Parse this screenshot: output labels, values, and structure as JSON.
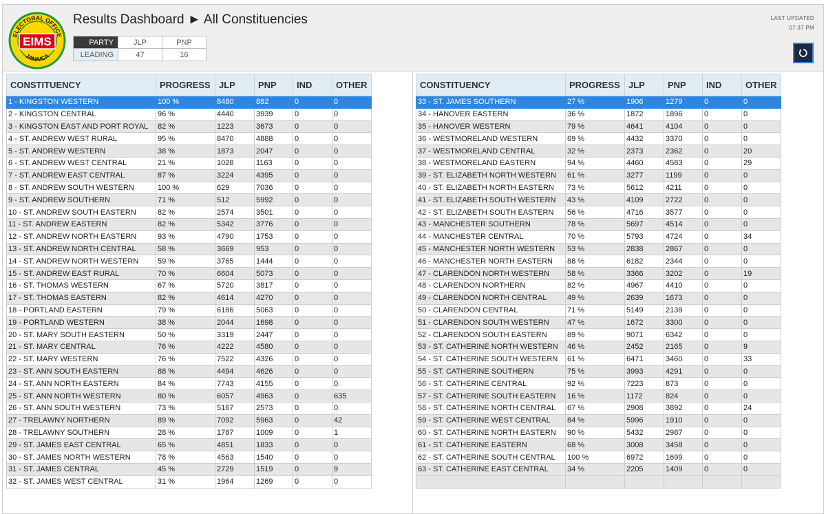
{
  "header": {
    "title": "Results Dashboard ► All Constituencies",
    "last_updated_label": "LAST UPDATED",
    "last_updated_time": "07:37 PM"
  },
  "logo": {
    "text": "EIMS",
    "arc_top": "ELECTORAL OFFICE",
    "arc_bottom": "JAMAICA",
    "colors": {
      "red": "#e0001b",
      "yellow": "#ffd500",
      "green": "#1f9a3a"
    }
  },
  "party_summary": {
    "party_label": "PARTY",
    "leading_label": "LEADING",
    "parties": [
      {
        "name": "JLP",
        "leading": "47"
      },
      {
        "name": "PNP",
        "leading": "16"
      }
    ]
  },
  "columns": [
    "CONSTITUENCY",
    "PROGRESS",
    "JLP",
    "PNP",
    "IND",
    "OTHER"
  ],
  "left_table": {
    "rows": [
      [
        "1 - KINGSTON WESTERN",
        "100 %",
        "8480",
        "882",
        "0",
        "0"
      ],
      [
        "2 - KINGSTON CENTRAL",
        "96 %",
        "4440",
        "3939",
        "0",
        "0"
      ],
      [
        "3 - KINGSTON EAST AND PORT ROYAL",
        "82 %",
        "1223",
        "3673",
        "0",
        "0"
      ],
      [
        "4 - ST. ANDREW WEST RURAL",
        "95 %",
        "8470",
        "4888",
        "0",
        "0"
      ],
      [
        "5 - ST. ANDREW WESTERN",
        "38 %",
        "1873",
        "2047",
        "0",
        "0"
      ],
      [
        "6 - ST. ANDREW WEST CENTRAL",
        "21 %",
        "1028",
        "1163",
        "0",
        "0"
      ],
      [
        "7 - ST. ANDREW EAST CENTRAL",
        "87 %",
        "3224",
        "4395",
        "0",
        "0"
      ],
      [
        "8 - ST. ANDREW SOUTH WESTERN",
        "100 %",
        "629",
        "7036",
        "0",
        "0"
      ],
      [
        "9 - ST. ANDREW SOUTHERN",
        "71 %",
        "512",
        "5992",
        "0",
        "0"
      ],
      [
        "10 - ST. ANDREW SOUTH EASTERN",
        "82 %",
        "2574",
        "3501",
        "0",
        "0"
      ],
      [
        "11 - ST. ANDREW EASTERN",
        "82 %",
        "5342",
        "3776",
        "0",
        "0"
      ],
      [
        "12 - ST. ANDREW NORTH EASTERN",
        "93 %",
        "4790",
        "1753",
        "0",
        "0"
      ],
      [
        "13 - ST. ANDREW NORTH CENTRAL",
        "58 %",
        "3669",
        "953",
        "0",
        "0"
      ],
      [
        "14 - ST. ANDREW NORTH WESTERN",
        "59 %",
        "3765",
        "1444",
        "0",
        "0"
      ],
      [
        "15 - ST. ANDREW EAST RURAL",
        "70 %",
        "6604",
        "5073",
        "0",
        "0"
      ],
      [
        "16 - ST. THOMAS WESTERN",
        "67 %",
        "5720",
        "3817",
        "0",
        "0"
      ],
      [
        "17 - ST. THOMAS EASTERN",
        "82 %",
        "4614",
        "4270",
        "0",
        "0"
      ],
      [
        "18 - PORTLAND EASTERN",
        "79 %",
        "6186",
        "5063",
        "0",
        "0"
      ],
      [
        "19 - PORTLAND WESTERN",
        "38 %",
        "2044",
        "1698",
        "0",
        "0"
      ],
      [
        "20 - ST. MARY SOUTH EASTERN",
        "50 %",
        "3319",
        "2447",
        "0",
        "0"
      ],
      [
        "21 - ST. MARY CENTRAL",
        "76 %",
        "4222",
        "4580",
        "0",
        "0"
      ],
      [
        "22 - ST. MARY WESTERN",
        "76 %",
        "7522",
        "4326",
        "0",
        "0"
      ],
      [
        "23 - ST. ANN SOUTH EASTERN",
        "88 %",
        "4494",
        "4626",
        "0",
        "0"
      ],
      [
        "24 - ST. ANN NORTH EASTERN",
        "84 %",
        "7743",
        "4155",
        "0",
        "0"
      ],
      [
        "25 - ST. ANN NORTH WESTERN",
        "80 %",
        "6057",
        "4963",
        "0",
        "635"
      ],
      [
        "26 - ST. ANN SOUTH WESTERN",
        "73 %",
        "5167",
        "2573",
        "0",
        "0"
      ],
      [
        "27 - TRELAWNY NORTHERN",
        "89 %",
        "7092",
        "5963",
        "0",
        "42"
      ],
      [
        "28 - TRELAWNY SOUTHERN",
        "28 %",
        "1767",
        "1009",
        "0",
        "1"
      ],
      [
        "29 - ST. JAMES EAST CENTRAL",
        "65 %",
        "4851",
        "1833",
        "0",
        "0"
      ],
      [
        "30 - ST. JAMES NORTH WESTERN",
        "78 %",
        "4563",
        "1540",
        "0",
        "0"
      ],
      [
        "31 - ST. JAMES CENTRAL",
        "45 %",
        "2729",
        "1519",
        "0",
        "9"
      ],
      [
        "32 - ST. JAMES WEST CENTRAL",
        "31 %",
        "1964",
        "1269",
        "0",
        "0"
      ]
    ]
  },
  "right_table": {
    "rows": [
      [
        "33 - ST. JAMES SOUTHERN",
        "27 %",
        "1906",
        "1279",
        "0",
        "0"
      ],
      [
        "34 - HANOVER EASTERN",
        "36 %",
        "1872",
        "1896",
        "0",
        "0"
      ],
      [
        "35 - HANOVER WESTERN",
        "79 %",
        "4641",
        "4104",
        "0",
        "0"
      ],
      [
        "36 - WESTMORELAND WESTERN",
        "69 %",
        "4432",
        "3370",
        "0",
        "0"
      ],
      [
        "37 - WESTMORELAND CENTRAL",
        "32 %",
        "2373",
        "2362",
        "0",
        "20"
      ],
      [
        "38 - WESTMORELAND EASTERN",
        "94 %",
        "4460",
        "4583",
        "0",
        "29"
      ],
      [
        "39 - ST. ELIZABETH NORTH WESTERN",
        "61 %",
        "3277",
        "1199",
        "0",
        "0"
      ],
      [
        "40 - ST. ELIZABETH NORTH EASTERN",
        "73 %",
        "5612",
        "4211",
        "0",
        "0"
      ],
      [
        "41 - ST. ELIZABETH SOUTH WESTERN",
        "43 %",
        "4109",
        "2722",
        "0",
        "0"
      ],
      [
        "42 - ST. ELIZABETH SOUTH EASTERN",
        "56 %",
        "4716",
        "3577",
        "0",
        "0"
      ],
      [
        "43 - MANCHESTER SOUTHERN",
        "78 %",
        "5697",
        "4514",
        "0",
        "0"
      ],
      [
        "44 - MANCHESTER CENTRAL",
        "70 %",
        "5793",
        "4724",
        "0",
        "34"
      ],
      [
        "45 - MANCHESTER NORTH WESTERN",
        "53 %",
        "2838",
        "2867",
        "0",
        "0"
      ],
      [
        "46 - MANCHESTER NORTH EASTERN",
        "88 %",
        "6182",
        "2344",
        "0",
        "0"
      ],
      [
        "47 - CLARENDON NORTH WESTERN",
        "58 %",
        "3366",
        "3202",
        "0",
        "19"
      ],
      [
        "48 - CLARENDON NORTHERN",
        "82 %",
        "4967",
        "4410",
        "0",
        "0"
      ],
      [
        "49 - CLARENDON NORTH CENTRAL",
        "49 %",
        "2639",
        "1673",
        "0",
        "0"
      ],
      [
        "50 - CLARENDON CENTRAL",
        "71 %",
        "5149",
        "2138",
        "0",
        "0"
      ],
      [
        "51 - CLARENDON SOUTH WESTERN",
        "47 %",
        "1672",
        "3300",
        "0",
        "0"
      ],
      [
        "52 - CLARENDON SOUTH EASTERN",
        "89 %",
        "9071",
        "6342",
        "0",
        "0"
      ],
      [
        "53 - ST. CATHERINE NORTH WESTERN",
        "46 %",
        "2452",
        "2165",
        "0",
        "9"
      ],
      [
        "54 - ST. CATHERINE SOUTH WESTERN",
        "61 %",
        "6471",
        "3460",
        "0",
        "33"
      ],
      [
        "55 - ST. CATHERINE SOUTHERN",
        "75 %",
        "3993",
        "4291",
        "0",
        "0"
      ],
      [
        "56 - ST. CATHERINE CENTRAL",
        "92 %",
        "7223",
        "873",
        "0",
        "0"
      ],
      [
        "57 - ST. CATHERINE SOUTH EASTERN",
        "16 %",
        "1172",
        "824",
        "0",
        "0"
      ],
      [
        "58 - ST. CATHERINE NORTH CENTRAL",
        "67 %",
        "2908",
        "3892",
        "0",
        "24"
      ],
      [
        "59 - ST. CATHERINE WEST CENTRAL",
        "84 %",
        "5996",
        "1910",
        "0",
        "0"
      ],
      [
        "60 - ST. CATHERINE NORTH EASTERN",
        "90 %",
        "5432",
        "2987",
        "0",
        "0"
      ],
      [
        "61 - ST. CATHERINE EASTERN",
        "68 %",
        "3008",
        "3458",
        "0",
        "0"
      ],
      [
        "62 - ST. CATHERINE SOUTH CENTRAL",
        "100 %",
        "6972",
        "1699",
        "0",
        "0"
      ],
      [
        "63 - ST. CATHERINE EAST CENTRAL",
        "34 %",
        "2205",
        "1409",
        "0",
        "0"
      ],
      [
        "",
        "",
        "",
        "",
        "",
        ""
      ]
    ]
  },
  "icons": {
    "refresh": "refresh-icon"
  },
  "selection_color": "#2e86e0"
}
